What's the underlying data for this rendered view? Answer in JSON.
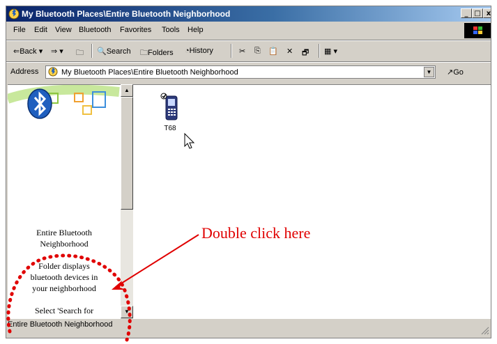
{
  "window": {
    "title": "My Bluetooth Places\\Entire Bluetooth Neighborhood",
    "minimize_symbol": "_",
    "maximize_symbol": "□",
    "close_symbol": "x"
  },
  "menu": [
    "File",
    "Edit",
    "View",
    "Bluetooth",
    "Favorites",
    "Tools",
    "Help"
  ],
  "toolbar": {
    "back_label": "⇐Back ▾",
    "forward_label": "⇒ ▾",
    "up_label": "🗀",
    "search_label": "Search",
    "folders_label": "Folders",
    "history_label": "History",
    "cut": "✂",
    "copy": "⎘",
    "paste": "📋",
    "delete": "✕",
    "properties": "🗗",
    "views_label": "▦ ▾"
  },
  "address": {
    "label": "Address",
    "value": "My Bluetooth Places\\Entire Bluetooth Neighborhood",
    "go_label": "Go",
    "go_arrow": "↗"
  },
  "left_pane": {
    "heading_line1": "Entire Bluetooth",
    "heading_line2": "Neighborhood",
    "desc_line1": "Folder displays",
    "desc_line2": "bluetooth devices in",
    "desc_line3": "your neighborhood",
    "hint_line1": "Select 'Search for"
  },
  "devices": [
    {
      "name": "T68",
      "icon": "mobile-phone-icon"
    }
  ],
  "annotation": {
    "text": "Double click here",
    "color": "#e00000"
  },
  "status": {
    "text": "Entire Bluetooth Neighborhood"
  },
  "colors": {
    "titlebar_start": "#0a246a",
    "titlebar_end": "#a6caf0",
    "chrome": "#d4d0c8",
    "bluetooth_blue": "#1f5fbf",
    "annotation_red": "#e00000"
  }
}
